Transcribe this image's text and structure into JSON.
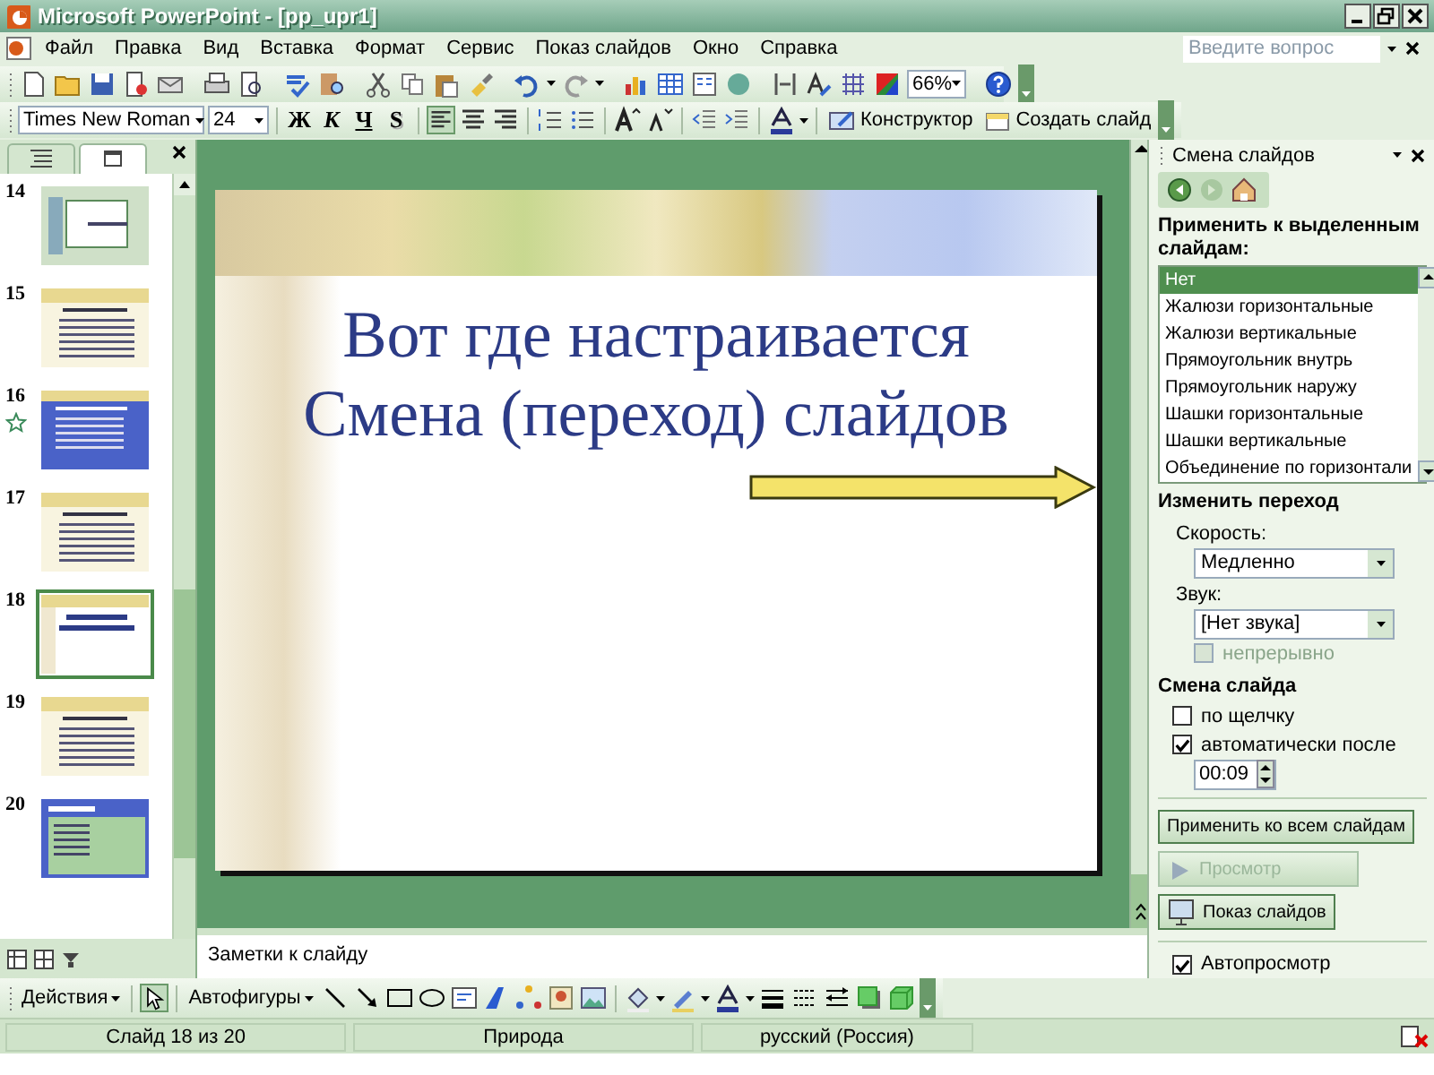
{
  "window": {
    "title": "Microsoft PowerPoint - [pp_upr1]"
  },
  "menu": [
    "Файл",
    "Правка",
    "Вид",
    "Вставка",
    "Формат",
    "Сервис",
    "Показ слайдов",
    "Окно",
    "Справка"
  ],
  "help_field": {
    "placeholder": "Введите вопрос"
  },
  "standard_toolbar": {
    "zoom": "66%"
  },
  "formatting_toolbar": {
    "font": "Times New Roman",
    "size": "24",
    "style_buttons": [
      {
        "label": "Ж",
        "kind": "bold"
      },
      {
        "label": "К",
        "kind": "italic"
      },
      {
        "label": "Ч",
        "kind": "underline"
      },
      {
        "label": "S",
        "kind": "shadow"
      }
    ],
    "buttons": [
      {
        "label": "Конструктор",
        "kind": "design"
      },
      {
        "label": "Создать слайд",
        "kind": "new-slide"
      }
    ]
  },
  "slides_pane": {
    "tabs": [
      {
        "kind": "outline",
        "selected": false
      },
      {
        "kind": "slides",
        "selected": true
      }
    ],
    "thumbnails": [
      {
        "number": "14",
        "kind": "screenshot",
        "animated": false,
        "selected": false
      },
      {
        "number": "15",
        "kind": "bullets",
        "animated": false,
        "selected": false
      },
      {
        "number": "16",
        "kind": "blue",
        "animated": true,
        "selected": false
      },
      {
        "number": "17",
        "kind": "bullets",
        "animated": false,
        "selected": false
      },
      {
        "number": "18",
        "kind": "title",
        "animated": false,
        "selected": true
      },
      {
        "number": "19",
        "kind": "bullets",
        "animated": false,
        "selected": false
      },
      {
        "number": "20",
        "kind": "dialog",
        "animated": false,
        "selected": false
      }
    ]
  },
  "slide": {
    "title": "Вот где настраивается\nСмена (переход) слайдов"
  },
  "notes": {
    "placeholder": "Заметки к слайду"
  },
  "task_pane": {
    "title": "Смена слайдов",
    "apply_heading": "Применить к выделенным слайдам:",
    "transitions": [
      {
        "label": "Нет",
        "selected": true
      },
      {
        "label": "Жалюзи горизонтальные",
        "selected": false
      },
      {
        "label": "Жалюзи вертикальные",
        "selected": false
      },
      {
        "label": "Прямоугольник внутрь",
        "selected": false
      },
      {
        "label": "Прямоугольник наружу",
        "selected": false
      },
      {
        "label": "Шашки горизонтальные",
        "selected": false
      },
      {
        "label": "Шашки вертикальные",
        "selected": false
      },
      {
        "label": "Объединение по горизонтали",
        "selected": false
      }
    ],
    "modify_heading": "Изменить переход",
    "speed": {
      "label": "Скорость:",
      "value": "Медленно"
    },
    "sound": {
      "label": "Звук:",
      "value": "[Нет звука]"
    },
    "loop": {
      "label": "непрерывно",
      "checked": false,
      "disabled": true
    },
    "advance_heading": "Смена слайда",
    "on_click": {
      "label": "по щелчку",
      "checked": false
    },
    "automatically": {
      "label": "автоматически после",
      "checked": true
    },
    "time": "00:09",
    "apply_all_button": "Применить ко всем слайдам",
    "play_button": {
      "label": "Просмотр",
      "disabled": true
    },
    "slideshow_button": "Показ слайдов",
    "autopreview": {
      "label": "Автопросмотр",
      "checked": true
    }
  },
  "drawing_toolbar": {
    "buttons": [
      "Действия",
      "Автофигуры"
    ]
  },
  "status_bar": [
    "Слайд 18 из 20",
    "Природа",
    "русский (Россия)"
  ]
}
